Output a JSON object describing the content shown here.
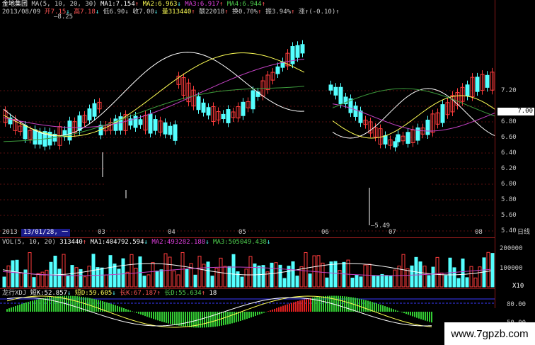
{
  "header": {
    "stock_name": "金地集团",
    "ma_title": "MA(5, 10, 20, 30)",
    "ma1": "MA1:7.154",
    "ma2": "MA2:6.963",
    "ma3": "MA3:6.917",
    "ma4": "MA4:6.944",
    "ma1_arrow": "↑",
    "ma2_arrow": "↓",
    "ma3_arrow": "↑",
    "ma4_arrow": "↑"
  },
  "quote": {
    "date": "2013/08/09",
    "open": "开7.15",
    "high": "高7.18",
    "low": "低6.90",
    "close": "收7.00",
    "volume": "量313440",
    "amount": "额22018",
    "turnover": "换0.70%",
    "amplitude": "振3.94%",
    "change": "涨↑(-0.10)↑",
    "arrow_down": "↓",
    "arrow_up": "↑"
  },
  "price_annotations": {
    "high_mark": "8.25",
    "low_mark": "5.49"
  },
  "price_axis": [
    "7.20",
    "7.00",
    "6.80",
    "6.60",
    "6.40",
    "6.20",
    "6.00",
    "5.80",
    "5.60",
    "5.40"
  ],
  "current_price": "7.00",
  "time_axis": {
    "labels": [
      "2013",
      "03",
      "04",
      "05",
      "06",
      "07",
      "08"
    ],
    "cursor_label": "13/01/28, 一",
    "period_label": "日线"
  },
  "volume_panel": {
    "title": "VOL(5, 10, 20)",
    "vol": "313440",
    "ma1": "MA1:404792.594",
    "ma2": "MA2:493282.188",
    "ma3": "MA3:505049.438",
    "axis": [
      "200000",
      "100000",
      "X10"
    ]
  },
  "indicator_panel": {
    "name": "龙行XDJ",
    "k_label": "短K:52.857",
    "d_label": "短D:59.605",
    "long_k": "长K:67.187",
    "long_d": "长D:55.634",
    "level": "18",
    "axis": [
      "80.00",
      "50.00"
    ]
  },
  "watermark": "www.7gpzb.com",
  "colors": {
    "bg": "#000000",
    "up_red": "#ff3c3c",
    "down_cyan": "#54ffff",
    "ma_white": "#ffffff",
    "ma_yellow": "#ffff55",
    "ma_purple": "#c542c5",
    "ma_green": "#3c9a3c",
    "separator": "#8b1a1a"
  }
}
